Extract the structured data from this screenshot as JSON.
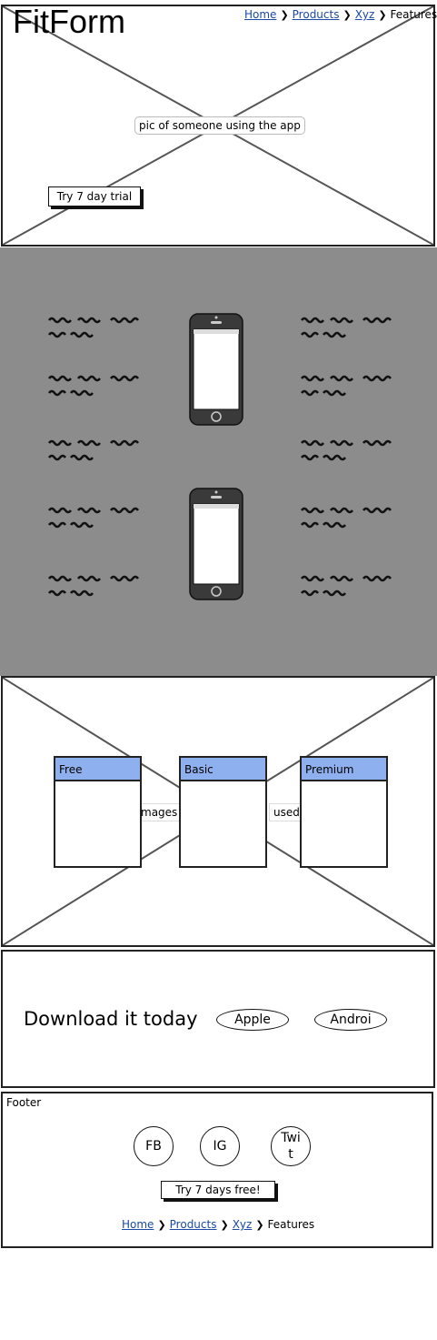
{
  "header": {
    "logo": "FitForm",
    "breadcrumb": {
      "items": [
        "Home",
        "Products",
        "Xyz"
      ],
      "current": "Features"
    },
    "hero_image_label": "pic of someone using the app",
    "trial_button": "Try 7 day trial"
  },
  "features": {
    "background_color": "#8c8c8c"
  },
  "pricing": {
    "bg_label_left": "mages",
    "bg_label_right": "used",
    "plans": [
      {
        "name": "Free"
      },
      {
        "name": "Basic"
      },
      {
        "name": "Premium"
      }
    ],
    "header_color": "#8fb0ee"
  },
  "download": {
    "heading": "Download it today",
    "apple_button": "Apple",
    "android_button": "Androi"
  },
  "footer": {
    "label": "Footer",
    "social": [
      "FB",
      "IG",
      "Twit"
    ],
    "trial_button": "Try 7 days free!",
    "breadcrumb": {
      "items": [
        "Home",
        "Products",
        "Xyz"
      ],
      "current": "Features"
    }
  }
}
